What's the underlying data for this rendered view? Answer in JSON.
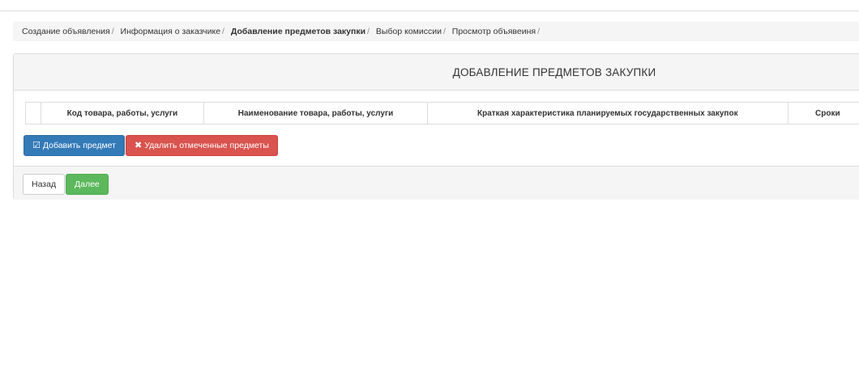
{
  "breadcrumb": {
    "items": [
      {
        "label": "Создание объявления",
        "separator": "/"
      },
      {
        "label": "Информация о заказчике",
        "separator": "/"
      },
      {
        "label": "Добавление предметов закупки",
        "separator": "/"
      },
      {
        "label": "Выбор комиссии",
        "separator": "/"
      },
      {
        "label": "Просмотр объявеиня",
        "separator": "/"
      }
    ]
  },
  "panel": {
    "title": "ДОБАВЛЕНИЕ ПРЕДМЕТОВ ЗАКУПКИ",
    "table": {
      "columns": [
        "",
        "Код товара, работы, услуги",
        "Наименование товара, работы, услуги",
        "Краткая характеристика планируемых государственных закупок",
        "Сроки"
      ],
      "rows": []
    },
    "add_button": {
      "icon": "check-square-icon",
      "glyph": "☑",
      "label": "Добавить предмет"
    },
    "delete_button": {
      "icon": "close-icon",
      "glyph": "✖",
      "label": "Удалить отмеченные предметы"
    }
  },
  "footer": {
    "back_label": "Назад",
    "next_label": "Далее"
  },
  "colors": {
    "primary": "#337ab7",
    "danger": "#d9534f",
    "success": "#5cb85c",
    "panel_bg": "#f5f5f5",
    "border": "#dddddd"
  }
}
